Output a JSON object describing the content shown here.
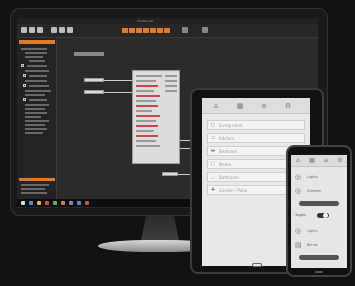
{
  "desktop": {
    "window_title": "FlexBuilder"
  },
  "tablet": {
    "toolbar_icons": [
      "home-icon",
      "grid-icon",
      "list-icon",
      "gear-icon"
    ],
    "items": [
      {
        "icon": "bulb-icon",
        "label": "Living room"
      },
      {
        "icon": "sofa-icon",
        "label": "Kitchen"
      },
      {
        "icon": "bed-icon",
        "label": "Bedroom"
      },
      {
        "icon": "tv-icon",
        "label": "Media"
      },
      {
        "icon": "bath-icon",
        "label": "Bathroom"
      },
      {
        "icon": "tree-icon",
        "label": "Garden / Patio"
      }
    ]
  },
  "phone": {
    "toolbar_icons": [
      "home-icon",
      "grid-icon",
      "list-icon",
      "gear-icon"
    ],
    "rows": [
      {
        "icon": "light-icon",
        "label": "Lights"
      },
      {
        "icon": "light-icon",
        "label": "Dimmer"
      },
      {
        "icon": "toggle-icon",
        "label": "Toggle"
      },
      {
        "icon": "light-icon",
        "label": "Lights"
      },
      {
        "icon": "blind-icon",
        "label": "Blinds"
      }
    ]
  },
  "colors": {
    "accent": "#e07b2a",
    "dark_bg": "#2b2b2b",
    "device_screen": "#e8e8e8"
  }
}
